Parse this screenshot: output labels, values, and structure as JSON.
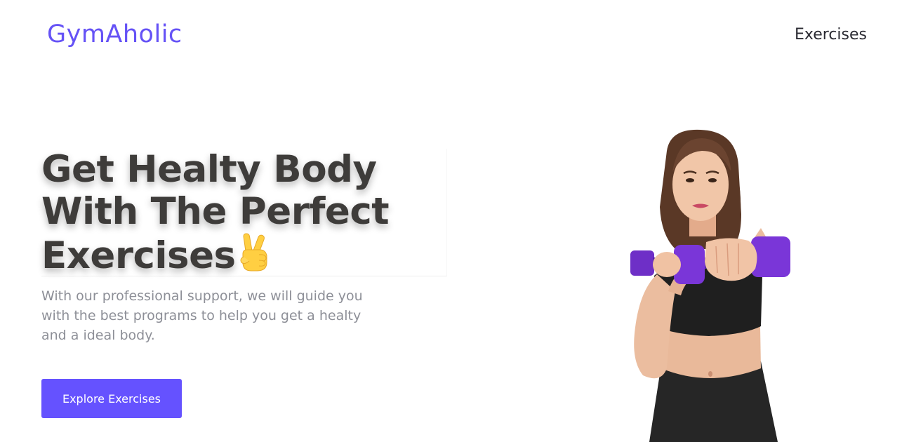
{
  "header": {
    "logo": "GymAholic",
    "nav": [
      {
        "label": "Exercises"
      }
    ]
  },
  "hero": {
    "title_lines": [
      "Get Healty Body",
      "With The Perfect",
      "Exercises"
    ],
    "title_emoji": "victory-hand-emoji",
    "description": "With our professional support, we will guide you with the best programs to help you get a healty and a ideal body.",
    "cta_label": "Explore Exercises",
    "image": "woman-holding-purple-dumbbell-photo"
  },
  "colors": {
    "accent": "#6552ff",
    "logo": "#6552f6",
    "title": "#3e3c3a",
    "description": "#8d8f97",
    "nav_text": "#2b2b33"
  }
}
